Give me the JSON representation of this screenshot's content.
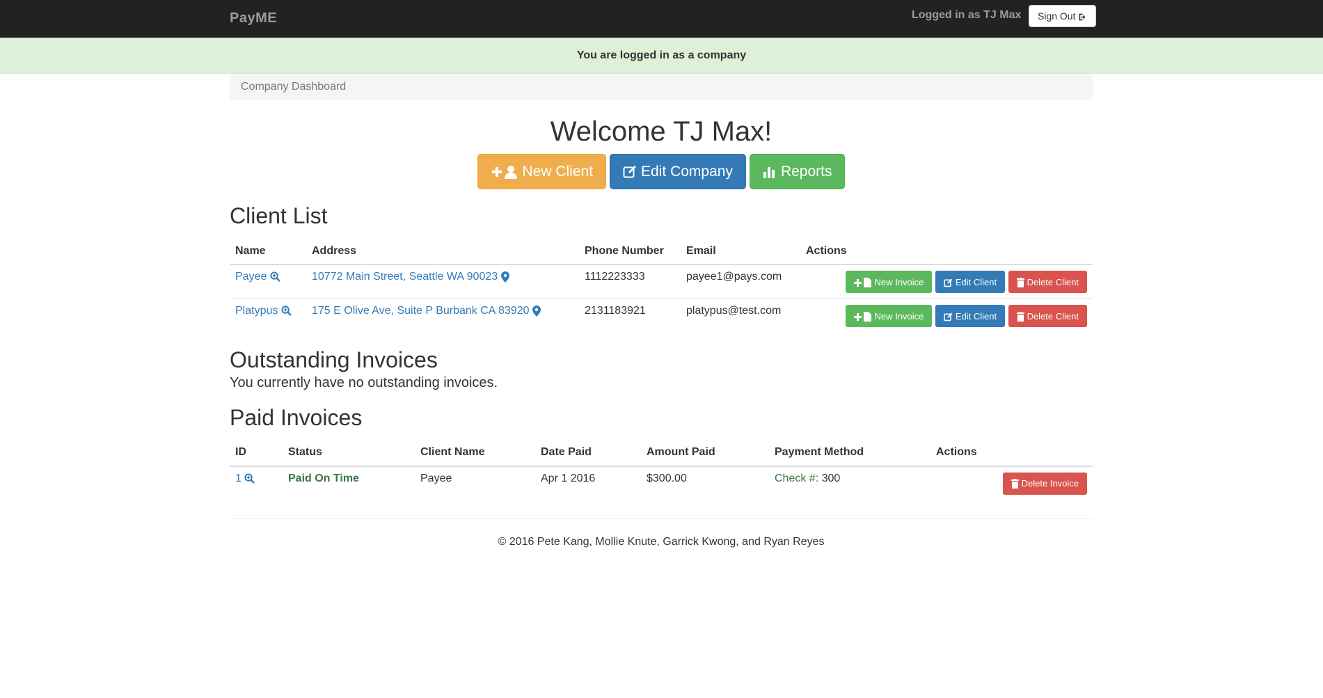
{
  "navbar": {
    "brand": "PayME",
    "user_text": "Logged in as TJ Max",
    "signout_label": "Sign Out"
  },
  "alert": {
    "text": "You are logged in as a company"
  },
  "breadcrumb": {
    "label": "Company Dashboard"
  },
  "welcome": {
    "title": "Welcome TJ Max!"
  },
  "actions": {
    "new_client": "New Client",
    "edit_company": "Edit Company",
    "reports": "Reports"
  },
  "client_list": {
    "title": "Client List",
    "headers": [
      "Name",
      "Address",
      "Phone Number",
      "Email",
      "Actions"
    ],
    "rows": [
      {
        "name": "Payee",
        "address": "10772 Main Street, Seattle WA 90023",
        "phone": "1112223333",
        "email": "payee1@pays.com"
      },
      {
        "name": "Platypus",
        "address": "175 E Olive Ave, Suite P Burbank CA 83920",
        "phone": "2131183921",
        "email": "platypus@test.com"
      }
    ],
    "row_actions": {
      "new_invoice": "New Invoice",
      "edit_client": "Edit Client",
      "delete_client": "Delete Client"
    }
  },
  "outstanding": {
    "title": "Outstanding Invoices",
    "empty_text": "You currently have no outstanding invoices."
  },
  "paid": {
    "title": "Paid Invoices",
    "headers": [
      "ID",
      "Status",
      "Client Name",
      "Date Paid",
      "Amount Paid",
      "Payment Method",
      "Actions"
    ],
    "rows": [
      {
        "id": "1",
        "status": "Paid On Time",
        "client": "Payee",
        "date": "Apr 1 2016",
        "amount": "$300.00",
        "method_label": "Check #:",
        "method_value": "300"
      }
    ],
    "delete_label": "Delete Invoice"
  },
  "footer": {
    "text": "© 2016 Pete Kang, Mollie Knute, Garrick Kwong, and Ryan Reyes"
  },
  "colors": {
    "navbar": "#222222",
    "alert": "#dff0d8",
    "primary": "#337ab7",
    "success": "#5cb85c",
    "warning": "#f0ad4e",
    "danger": "#d9534f"
  }
}
